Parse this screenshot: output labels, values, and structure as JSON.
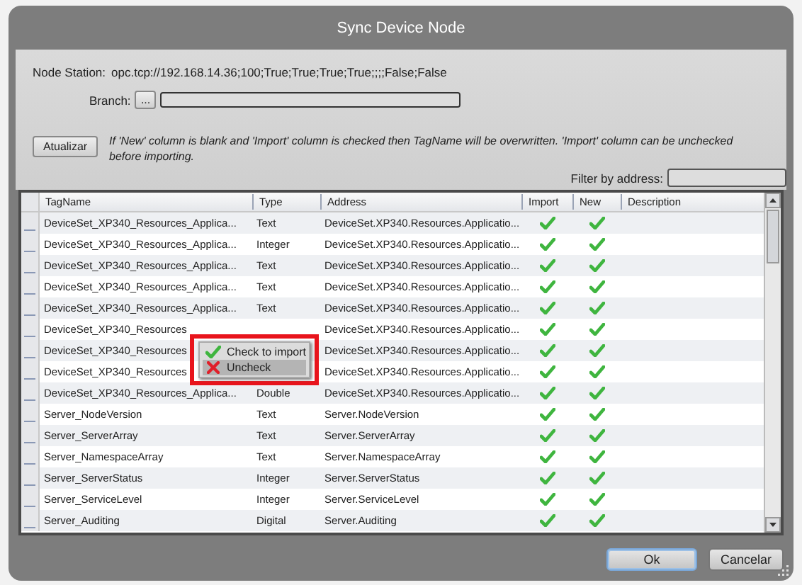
{
  "window": {
    "title": "Sync Device Node"
  },
  "node_station": {
    "label": "Node Station:",
    "value": "opc.tcp://192.168.14.36;100;True;True;True;True;;;;False;False"
  },
  "branch": {
    "label": "Branch:",
    "browse_button": "..."
  },
  "refresh_button": "Atualizar",
  "info": "If 'New' column is blank and 'Import' column is checked then TagName will be overwritten. 'Import' column can be unchecked before importing.",
  "filter": {
    "label": "Filter by address:"
  },
  "table": {
    "columns": [
      "TagName",
      "Type",
      "Address",
      "Import",
      "New",
      "Description"
    ],
    "rows": [
      {
        "tag_name": "DeviceSet_XP340_Resources_Applica...",
        "type": "Text",
        "address": "DeviceSet.XP340.Resources.Applicatio...",
        "import": true,
        "new": true
      },
      {
        "tag_name": "DeviceSet_XP340_Resources_Applica...",
        "type": "Integer",
        "address": "DeviceSet.XP340.Resources.Applicatio...",
        "import": true,
        "new": true
      },
      {
        "tag_name": "DeviceSet_XP340_Resources_Applica...",
        "type": "Text",
        "address": "DeviceSet.XP340.Resources.Applicatio...",
        "import": true,
        "new": true
      },
      {
        "tag_name": "DeviceSet_XP340_Resources_Applica...",
        "type": "Text",
        "address": "DeviceSet.XP340.Resources.Applicatio...",
        "import": true,
        "new": true
      },
      {
        "tag_name": "DeviceSet_XP340_Resources_Applica...",
        "type": "Text",
        "address": "DeviceSet.XP340.Resources.Applicatio...",
        "import": true,
        "new": true
      },
      {
        "tag_name": "DeviceSet_XP340_Resources",
        "address": "DeviceSet.XP340.Resources.Applicatio...",
        "import": true,
        "new": true
      },
      {
        "tag_name": "DeviceSet_XP340_Resources",
        "address": "DeviceSet.XP340.Resources.Applicatio...",
        "import": true,
        "new": true
      },
      {
        "tag_name": "DeviceSet_XP340_Resources",
        "address": "DeviceSet.XP340.Resources.Applicatio...",
        "import": true,
        "new": true
      },
      {
        "tag_name": "DeviceSet_XP340_Resources_Applica...",
        "type": "Double",
        "address": "DeviceSet.XP340.Resources.Applicatio...",
        "import": true,
        "new": true
      },
      {
        "tag_name": "Server_NodeVersion",
        "type": "Text",
        "address": "Server.NodeVersion",
        "import": true,
        "new": true
      },
      {
        "tag_name": "Server_ServerArray",
        "type": "Text",
        "address": "Server.ServerArray",
        "import": true,
        "new": true
      },
      {
        "tag_name": "Server_NamespaceArray",
        "type": "Text",
        "address": "Server.NamespaceArray",
        "import": true,
        "new": true
      },
      {
        "tag_name": "Server_ServerStatus",
        "type": "Integer",
        "address": "Server.ServerStatus",
        "import": true,
        "new": true
      },
      {
        "tag_name": "Server_ServiceLevel",
        "type": "Integer",
        "address": "Server.ServiceLevel",
        "import": true,
        "new": true
      },
      {
        "tag_name": "Server_Auditing",
        "type": "Digital",
        "address": "Server.Auditing",
        "import": true,
        "new": true
      }
    ]
  },
  "context_menu": {
    "items": [
      {
        "label": "Check to import",
        "kind": "check",
        "selected": false
      },
      {
        "label": "Uncheck",
        "kind": "uncheck",
        "selected": true
      }
    ]
  },
  "buttons": [
    {
      "label": "Ok",
      "default": true
    },
    {
      "label": "Cancelar",
      "default": false
    }
  ]
}
